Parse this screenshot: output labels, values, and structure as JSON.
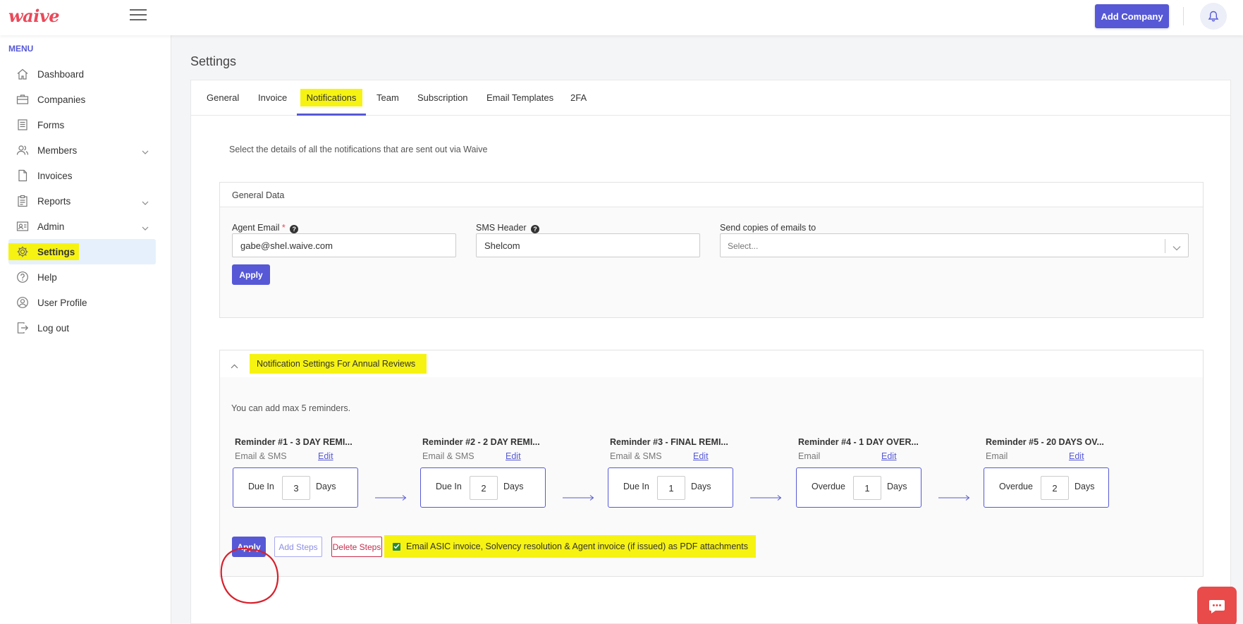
{
  "header": {
    "logo": "waive",
    "add_company_label": "Add Company"
  },
  "sidebar": {
    "menu_title": "MENU",
    "items": [
      {
        "label": "Dashboard",
        "icon": "home-icon"
      },
      {
        "label": "Companies",
        "icon": "briefcase-icon"
      },
      {
        "label": "Forms",
        "icon": "document-icon"
      },
      {
        "label": "Members",
        "icon": "users-icon",
        "has_children": true
      },
      {
        "label": "Invoices",
        "icon": "file-icon"
      },
      {
        "label": "Reports",
        "icon": "clipboard-icon",
        "has_children": true
      },
      {
        "label": "Admin",
        "icon": "id-card-icon",
        "has_children": true
      },
      {
        "label": "Settings",
        "icon": "gear-icon",
        "active": true
      },
      {
        "label": "Help",
        "icon": "help-circle-icon"
      },
      {
        "label": "User Profile",
        "icon": "user-icon"
      },
      {
        "label": "Log out",
        "icon": "logout-icon"
      }
    ]
  },
  "page": {
    "title": "Settings"
  },
  "tabs": [
    {
      "label": "General"
    },
    {
      "label": "Invoice"
    },
    {
      "label": "Notifications",
      "active": true
    },
    {
      "label": "Team"
    },
    {
      "label": "Subscription"
    },
    {
      "label": "Email Templates"
    },
    {
      "label": "2FA"
    }
  ],
  "notifications": {
    "description": "Select the details of all the notifications that are sent out via Waive",
    "general_data": {
      "title": "General Data",
      "agent_email_label": "Agent Email",
      "agent_email_required": "*",
      "agent_email_value": "gabe@shel.waive.com",
      "sms_header_label": "SMS Header",
      "sms_header_value": "Shelcom",
      "copies_label": "Send copies of emails to",
      "copies_placeholder": "Select...",
      "apply_label": "Apply"
    },
    "annual_reviews": {
      "title": "Notification Settings For Annual Reviews",
      "max_note": "You can add max 5 reminders.",
      "reminders": [
        {
          "title": "Reminder #1 - 3 DAY REMI...",
          "channel": "Email & SMS",
          "edit": "Edit",
          "mode": "Due In",
          "value": "3",
          "unit": "Days"
        },
        {
          "title": "Reminder #2 - 2 DAY REMI...",
          "channel": "Email & SMS",
          "edit": "Edit",
          "mode": "Due In",
          "value": "2",
          "unit": "Days"
        },
        {
          "title": "Reminder #3 - FINAL REMI...",
          "channel": "Email & SMS",
          "edit": "Edit",
          "mode": "Due In",
          "value": "1",
          "unit": "Days"
        },
        {
          "title": "Reminder #4 - 1 DAY OVER...",
          "channel": "Email",
          "edit": "Edit",
          "mode": "Overdue",
          "value": "1",
          "unit": "Days"
        },
        {
          "title": "Reminder #5 - 20 DAYS OV...",
          "channel": "Email",
          "edit": "Edit",
          "mode": "Overdue",
          "value": "2",
          "unit": "Days"
        }
      ],
      "apply_label": "Apply",
      "add_steps_label": "Add Steps",
      "delete_steps_label": "Delete Steps",
      "pdf_attach_label": "Email ASIC invoice, Solvency resolution & Agent invoice (if issued) as PDF attachments",
      "pdf_attach_checked": true
    }
  },
  "colors": {
    "accent": "#5658d6",
    "highlight": "#f6f312",
    "logo": "#e94a5a",
    "danger": "#c62d4d",
    "chat": "#e94a4a"
  }
}
